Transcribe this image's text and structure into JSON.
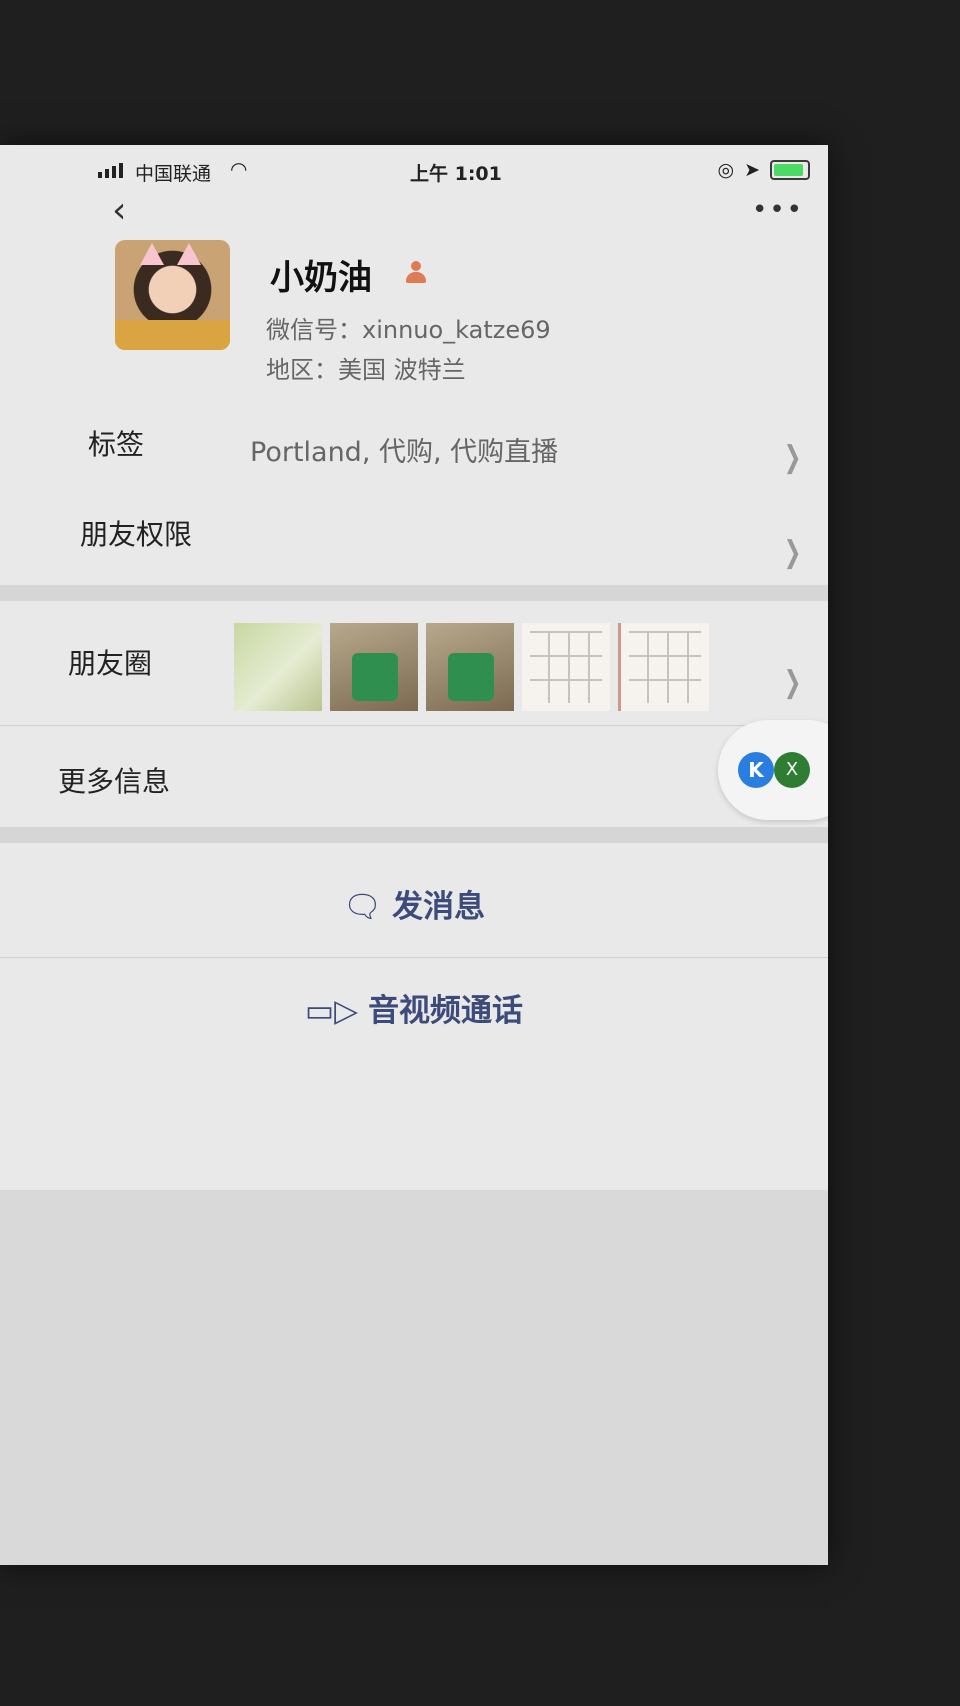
{
  "status_bar": {
    "carrier": "中国联通",
    "time": "上午 1:01",
    "battery_level": 0.8
  },
  "profile": {
    "nickname": "小奶油",
    "wechat_id": "微信号：xinnuo_katze69",
    "region": "地区：美国 波特兰"
  },
  "rows": {
    "tags_label": "标签",
    "tags_value": "Portland, 代购, 代购直播",
    "permissions_label": "朋友权限",
    "moments_label": "朋友圈",
    "more_info_label": "更多信息"
  },
  "floating": {
    "k_icon_text": "K",
    "x_icon_text": "X"
  },
  "actions": {
    "message_label": "发消息",
    "call_label": "音视频通话"
  },
  "icons": {
    "back": "chevron-left-icon",
    "more": "more-dots-icon",
    "person": "person-icon",
    "message": "chat-bubble-icon",
    "video": "video-camera-icon"
  }
}
